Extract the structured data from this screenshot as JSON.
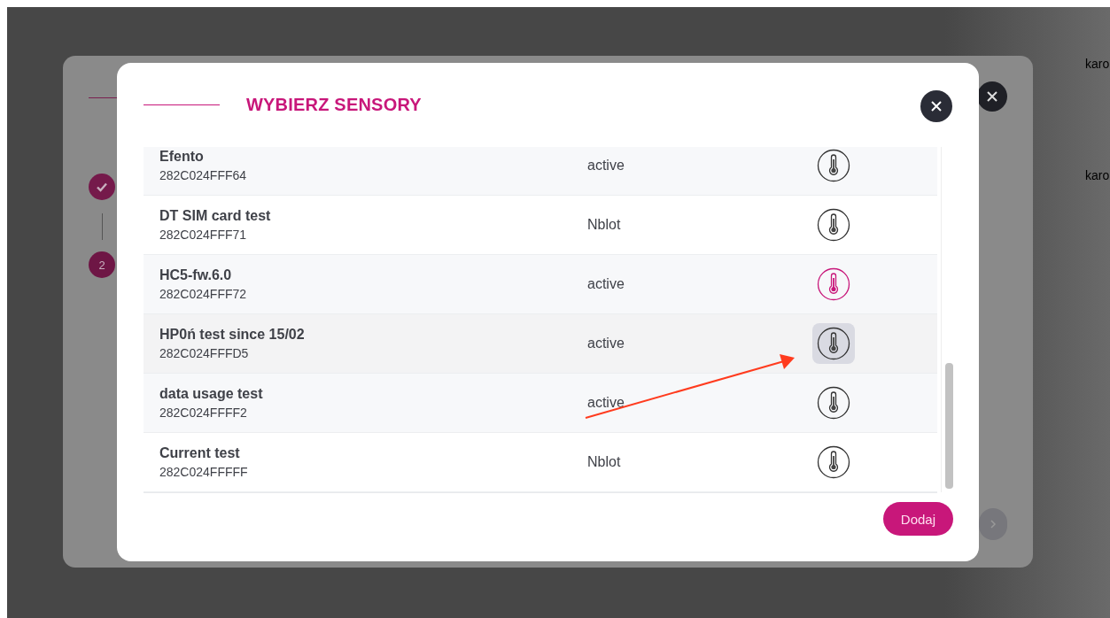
{
  "background": {
    "rows": [
      {
        "text": "karo"
      },
      {
        "text": "karo"
      }
    ]
  },
  "outer_dialog": {
    "steps": [
      {
        "done": true
      },
      {
        "done": false,
        "number": "2"
      }
    ]
  },
  "dialog": {
    "title": "WYBIERZ SENSORY",
    "sensors": [
      {
        "name": "Efento",
        "serial": "282C024FFF64",
        "status": "active",
        "selected": false,
        "hovered": false
      },
      {
        "name": "DT SIM card test",
        "serial": "282C024FFF71",
        "status": "Nblot",
        "selected": false,
        "hovered": false
      },
      {
        "name": "HC5-fw.6.0",
        "serial": "282C024FFF72",
        "status": "active",
        "selected": true,
        "hovered": false
      },
      {
        "name": "HP0ń test since 15/02",
        "serial": "282C024FFFD5",
        "status": "active",
        "selected": false,
        "hovered": true
      },
      {
        "name": "data usage test",
        "serial": "282C024FFFF2",
        "status": "active",
        "selected": false,
        "hovered": false
      },
      {
        "name": "Current test",
        "serial": "282C024FFFFF",
        "status": "Nblot",
        "selected": false,
        "hovered": false
      }
    ],
    "add_button": "Dodaj"
  }
}
